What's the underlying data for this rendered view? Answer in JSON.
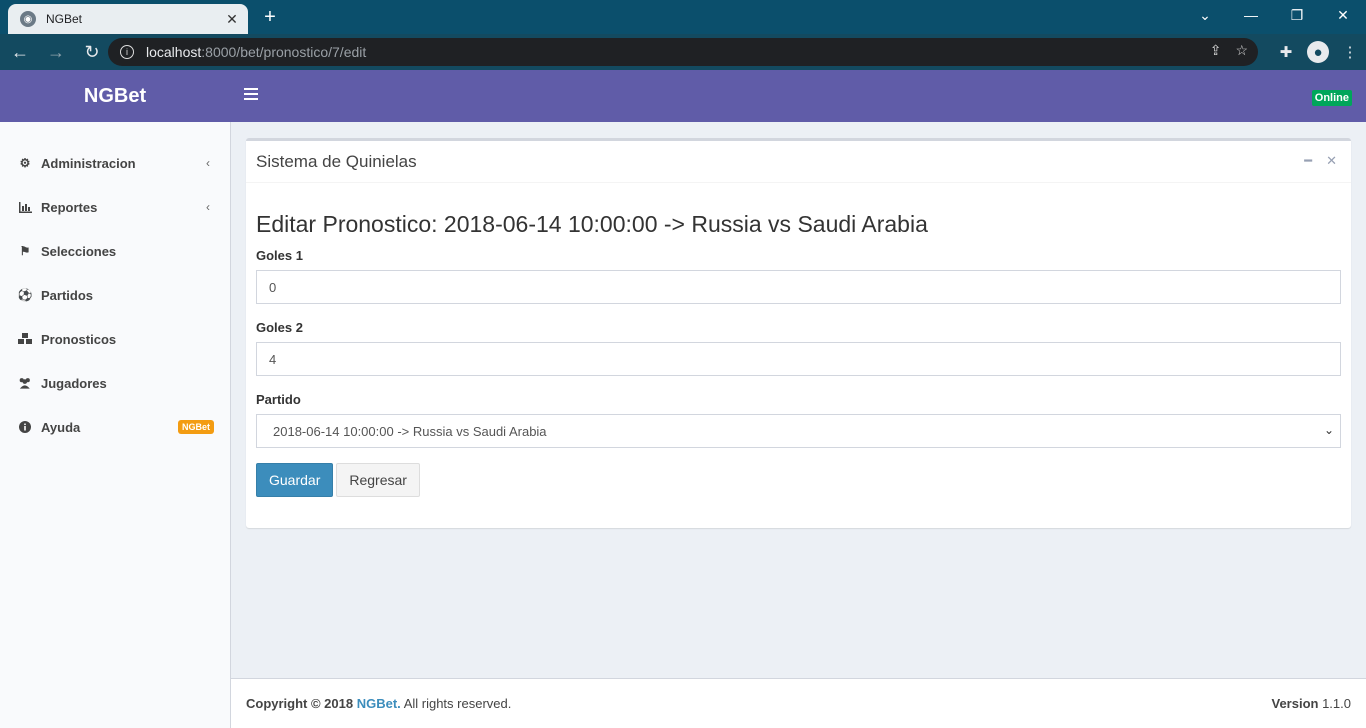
{
  "browser": {
    "tab_title": "NGBet",
    "new_tab": "+",
    "url_host": "localhost",
    "url_path": ":8000/bet/pronostico/7/edit"
  },
  "header": {
    "logo": "NGBet",
    "status": "Online"
  },
  "sidebar": {
    "items": [
      {
        "label": "Administracion",
        "icon": "gear-icon"
      },
      {
        "label": "Reportes",
        "icon": "bar-chart-icon"
      },
      {
        "label": "Selecciones",
        "icon": "flag-icon"
      },
      {
        "label": "Partidos",
        "icon": "soccer-ball-icon"
      },
      {
        "label": "Pronosticos",
        "icon": "cubes-icon"
      },
      {
        "label": "Jugadores",
        "icon": "users-icon"
      },
      {
        "label": "Ayuda",
        "icon": "info-icon",
        "badge": "NGBet"
      }
    ]
  },
  "box": {
    "title": "Sistema de Quinielas"
  },
  "form": {
    "heading": "Editar Pronostico: 2018-06-14 10:00:00 -> Russia vs Saudi Arabia",
    "goles1_label": "Goles 1",
    "goles1_value": "0",
    "goles2_label": "Goles 2",
    "goles2_value": "4",
    "partido_label": "Partido",
    "partido_selected": "2018-06-14 10:00:00 -> Russia vs Saudi Arabia",
    "save_label": "Guardar",
    "back_label": "Regresar"
  },
  "footer": {
    "copyright_prefix": "Copyright © 2018",
    "brand": "NGBet.",
    "rights": " All rights reserved.",
    "version_label": "Version",
    "version_value": "1.1.0"
  },
  "colors": {
    "header_bg": "#605ca8",
    "primary_button": "#3c8dbc",
    "status_badge": "#00a65a",
    "help_badge": "#f39c12"
  }
}
